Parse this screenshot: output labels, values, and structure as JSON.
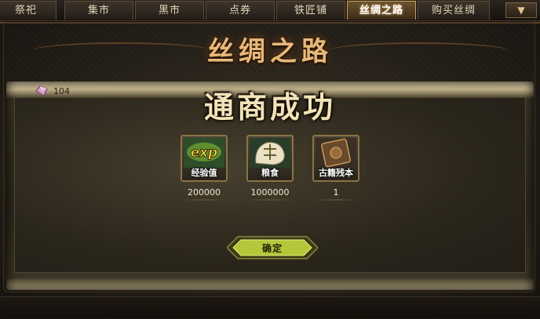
{
  "tabs": [
    {
      "label": "祭祀",
      "active": false
    },
    {
      "label": "集市",
      "active": false
    },
    {
      "label": "黑市",
      "active": false
    },
    {
      "label": "点券",
      "active": false
    },
    {
      "label": "铁匠铺",
      "active": false
    },
    {
      "label": "丝绸之路",
      "active": true
    },
    {
      "label": "购买丝绸",
      "active": false
    }
  ],
  "tab_arrow_icon": "chevron-down-icon",
  "panel": {
    "title": "丝绸之路",
    "silk_count": "104",
    "success_text": "通商成功"
  },
  "rewards": [
    {
      "icon": "exp-icon",
      "label": "经验值",
      "value": "200000"
    },
    {
      "icon": "grain-icon",
      "label": "粮食",
      "value": "1000000"
    },
    {
      "icon": "ancient-book-icon",
      "label": "古籍残本",
      "value": "1"
    }
  ],
  "confirm_label": "确定",
  "colors": {
    "title": "#e7b97a",
    "active_tab_border": "#c9a055",
    "confirm_button": "#b4c63a"
  }
}
